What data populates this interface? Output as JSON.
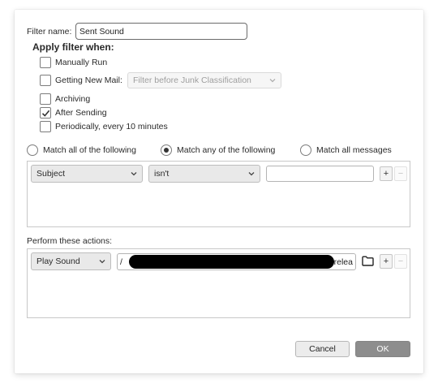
{
  "filter_name": {
    "label": "Filter name:",
    "value": "Sent Sound"
  },
  "apply_when": {
    "heading": "Apply filter when:",
    "manually_run": {
      "label": "Manually Run",
      "checked": false
    },
    "getting_new_mail": {
      "label": "Getting New Mail:",
      "checked": false,
      "select_value": "Filter before Junk Classification"
    },
    "archiving": {
      "label": "Archiving",
      "checked": false
    },
    "after_sending": {
      "label": "After Sending",
      "checked": true
    },
    "periodically": {
      "label": "Periodically, every 10 minutes",
      "checked": false
    }
  },
  "match": {
    "all": {
      "label": "Match all of the following",
      "selected": false
    },
    "any": {
      "label": "Match any of the following",
      "selected": true
    },
    "all_messages": {
      "label": "Match all messages",
      "selected": false
    }
  },
  "condition": {
    "field": "Subject",
    "operator": "isn't",
    "value": ""
  },
  "actions": {
    "label": "Perform these actions:",
    "action": "Play Sound",
    "path_start": "/",
    "path_end": "-relea"
  },
  "buttons": {
    "cancel": "Cancel",
    "ok": "OK"
  },
  "icons": {
    "checkmark": "check-icon",
    "chevron": "chevron-down-icon",
    "folder": "folder-icon"
  }
}
